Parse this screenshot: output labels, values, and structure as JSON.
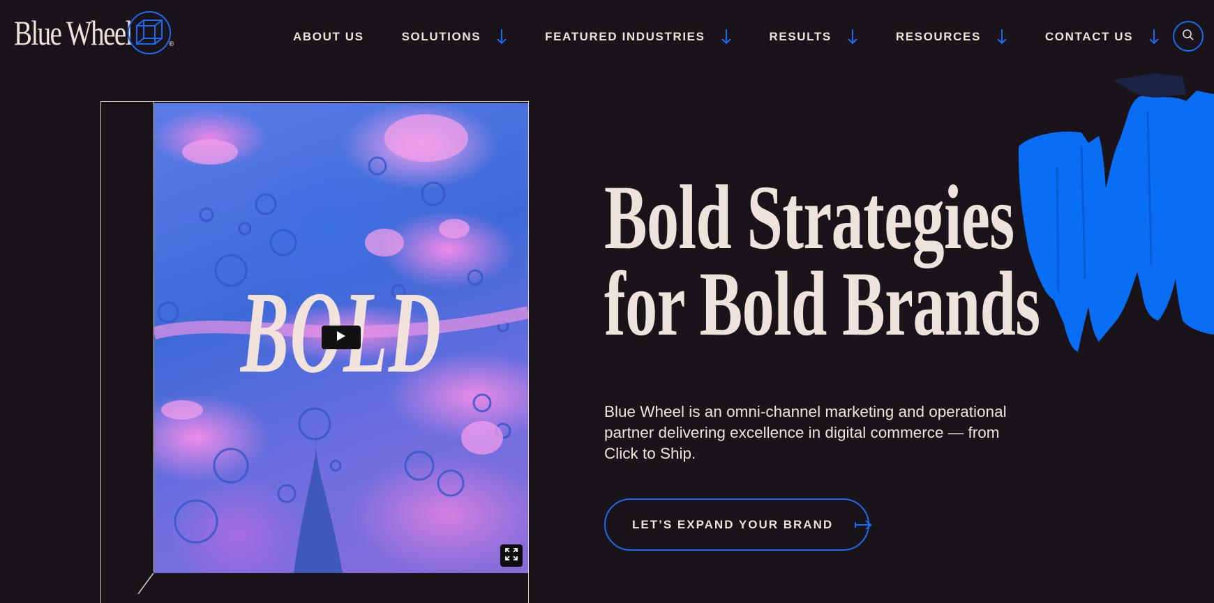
{
  "brand": {
    "name": "Blue Wheel",
    "registered_mark": "®"
  },
  "nav": {
    "items": [
      {
        "label": "ABOUT US",
        "has_dropdown": false
      },
      {
        "label": "SOLUTIONS",
        "has_dropdown": true
      },
      {
        "label": "FEATURED INDUSTRIES",
        "has_dropdown": true
      },
      {
        "label": "RESULTS",
        "has_dropdown": true
      },
      {
        "label": "RESOURCES",
        "has_dropdown": true
      },
      {
        "label": "CONTACT US",
        "has_dropdown": true
      }
    ],
    "dropdown_icon": "arrow-down-icon",
    "search_icon": "search-icon"
  },
  "video": {
    "overlay_word": "BOLD",
    "play_icon": "play-icon",
    "fullscreen_icon": "fullscreen-icon"
  },
  "hero": {
    "title_line1": "Bold Strategies",
    "title_line2": "for Bold Brands",
    "description": "Blue Wheel is an omni-channel marketing and operational partner delivering excellence in digital commerce — from Click to Ship.",
    "cta_label": "LET’S EXPAND YOUR BRAND",
    "cta_icon": "arrow-right-icon"
  },
  "colors": {
    "background": "#1b131a",
    "text": "#eee3dc",
    "accent": "#1a6cf2",
    "brush": "#0a6ef5"
  }
}
